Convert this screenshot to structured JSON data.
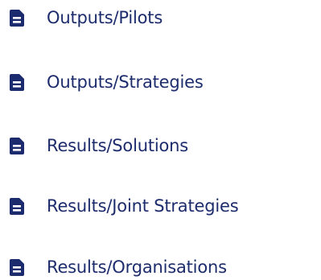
{
  "colors": {
    "icon": "#1b2b6e",
    "text": "#1c2c6c"
  },
  "items": [
    {
      "label": "Outputs/Pilots",
      "icon": "document-icon"
    },
    {
      "label": "Outputs/Strategies",
      "icon": "document-icon"
    },
    {
      "label": "Results/Solutions",
      "icon": "document-icon"
    },
    {
      "label": "Results/Joint Strategies",
      "icon": "document-icon"
    },
    {
      "label": "Results/Organisations",
      "icon": "document-icon"
    }
  ]
}
